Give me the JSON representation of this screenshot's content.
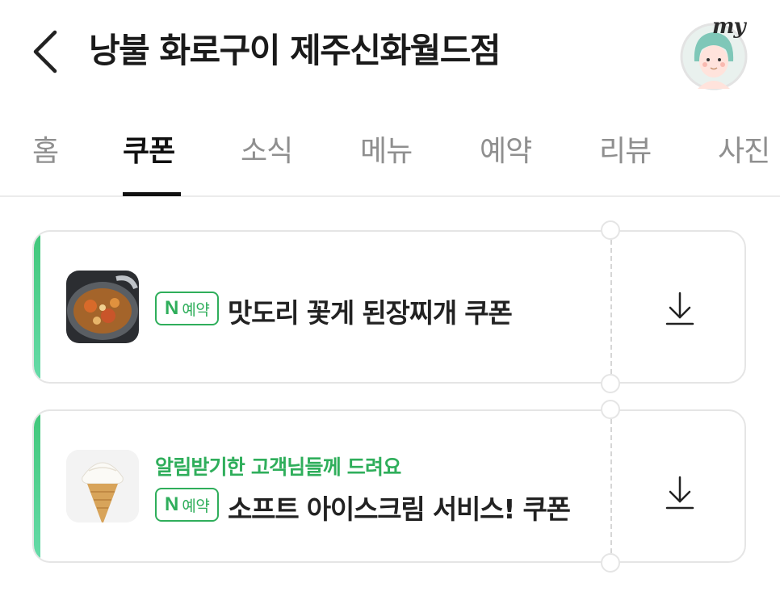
{
  "header": {
    "title": "낭불 화로구이 제주신화월드점",
    "my_label": "my"
  },
  "tabs": [
    {
      "label": "홈",
      "active": false
    },
    {
      "label": "쿠폰",
      "active": true
    },
    {
      "label": "소식",
      "active": false
    },
    {
      "label": "메뉴",
      "active": false
    },
    {
      "label": "예약",
      "active": false
    },
    {
      "label": "리뷰",
      "active": false
    },
    {
      "label": "사진",
      "active": false
    }
  ],
  "coupons": [
    {
      "promo": "",
      "badge_n": "N",
      "badge_text": "예약",
      "title": "맛도리 꽃게 된장찌개 쿠폰",
      "thumbnail": "doenjang-stew-image",
      "action_icon": "download-icon"
    },
    {
      "promo": "알림받기한 고객님들께 드려요",
      "badge_n": "N",
      "badge_text": "예약",
      "title": "소프트 아이스크림 서비스! 쿠폰",
      "thumbnail": "soft-ice-cream-image",
      "action_icon": "download-icon"
    }
  ],
  "colors": {
    "accent_green": "#2fae5b",
    "accent_gradient_start": "#41c77a",
    "accent_gradient_end": "#66dba9",
    "avatar_hair": "#7fc7b8"
  }
}
